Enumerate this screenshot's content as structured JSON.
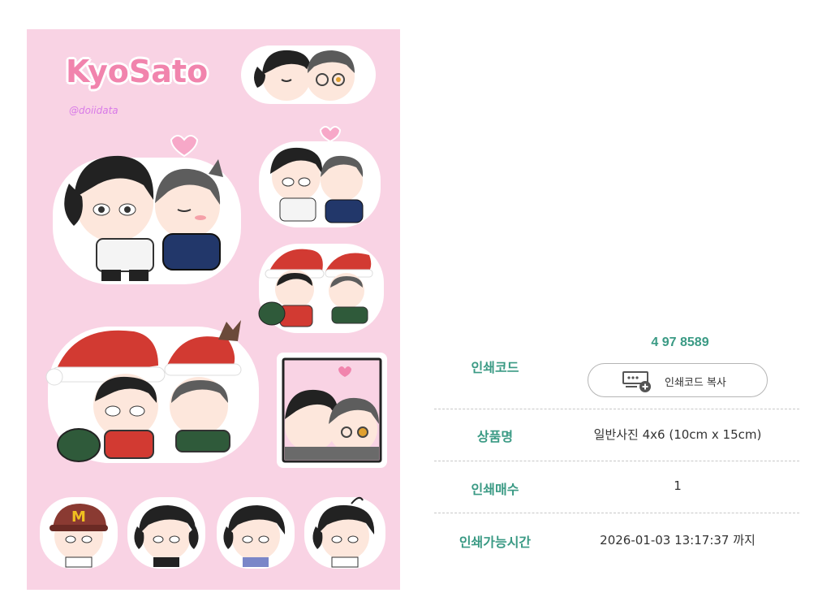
{
  "sheet": {
    "brand_title": "KyoSato",
    "handle": "@doiidata",
    "sticker_icons": [
      "kiss-heads-sticker",
      "couple-hug-sticker",
      "couple-small-sticker",
      "santa-couple-small-sticker",
      "santa-couple-large-sticker",
      "photo-frame-sticker",
      "cap-head-sticker",
      "head-sticker-2",
      "head-sticker-3",
      "head-sticker-4"
    ],
    "colors": {
      "background": "#f9d3e4",
      "title": "#f184ad",
      "handle": "#d879e8",
      "heart": "#f7a8c8"
    }
  },
  "info": {
    "code_number": "4 97 8589",
    "code_label": "인쇄코드",
    "copy_button_label": "인쇄코드 복사",
    "copy_button_icon": "copy-code-icon",
    "product_label": "상품명",
    "product_value": "일반사진 4x6 (10cm x 15cm)",
    "count_label": "인쇄매수",
    "count_value": "1",
    "time_label": "인쇄가능시간",
    "time_value": "2026-01-03 13:17:37 까지",
    "accent_color": "#3a9a84"
  }
}
